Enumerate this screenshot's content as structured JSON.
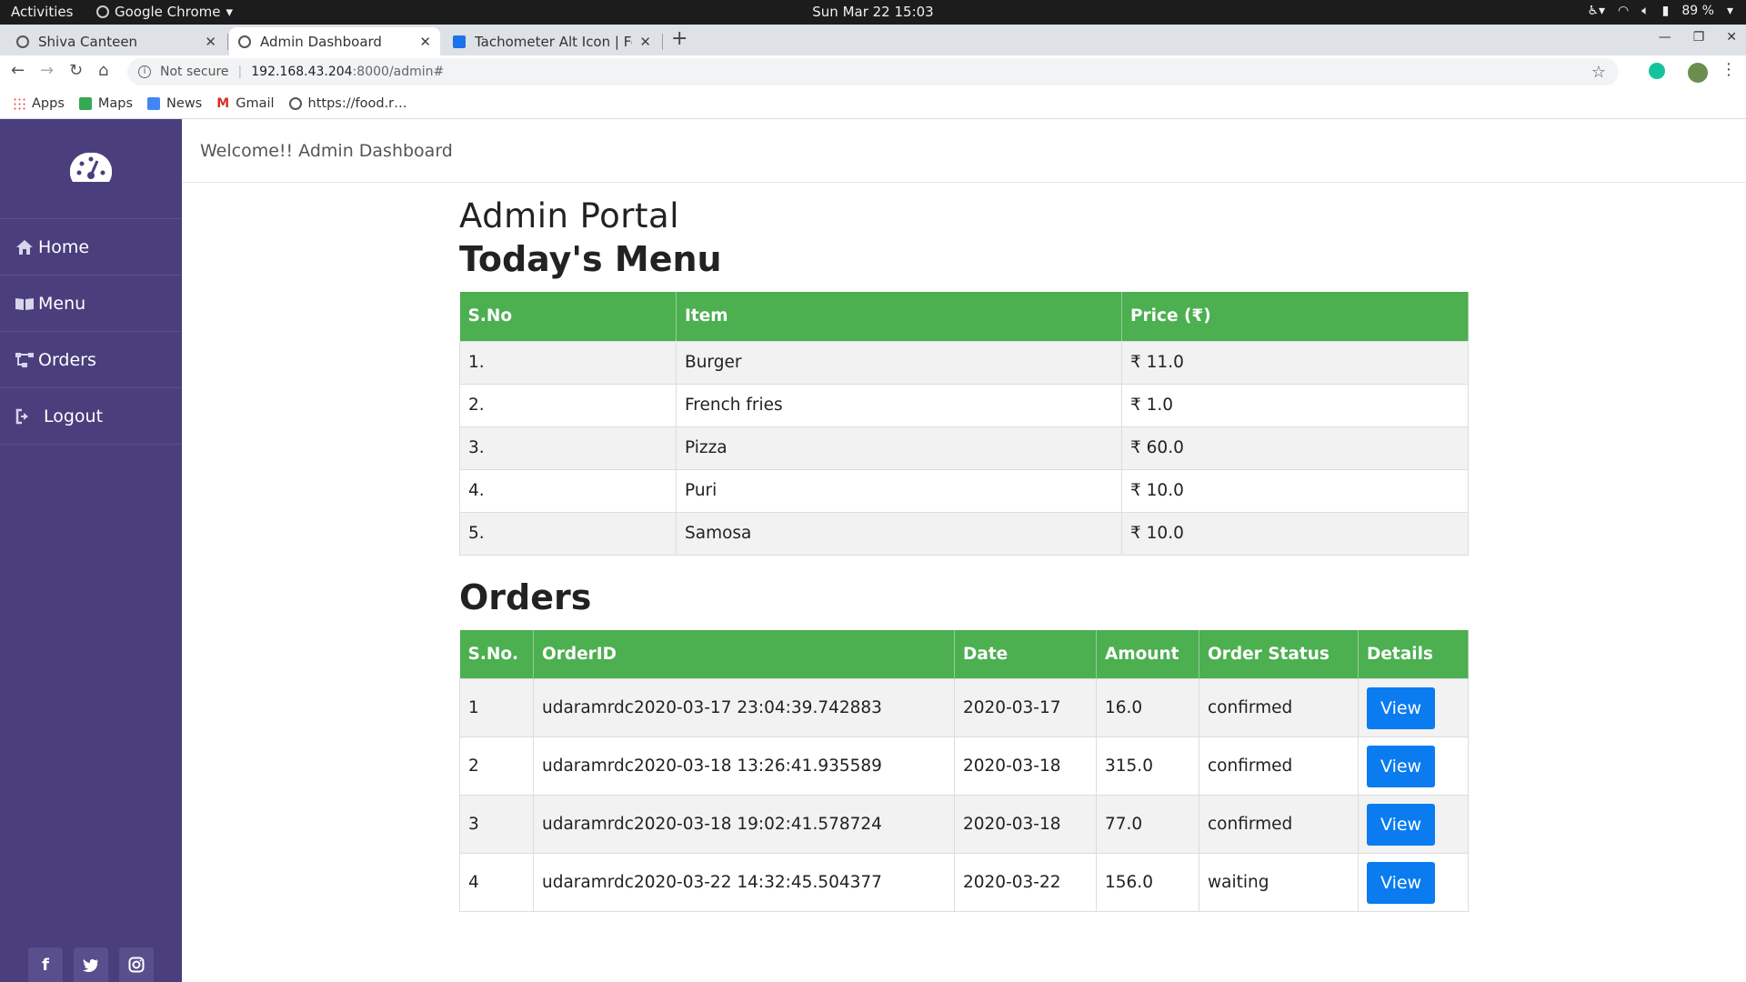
{
  "os": {
    "activities": "Activities",
    "app_name": "Google Chrome",
    "clock": "Sun Mar 22  15:03",
    "battery": "89 %"
  },
  "browser": {
    "tabs": [
      {
        "title": "Shiva Canteen",
        "active": false
      },
      {
        "title": "Admin Dashboard",
        "active": true
      },
      {
        "title": "Tachometer Alt Icon | Fon",
        "active": false
      }
    ],
    "url": {
      "security": "Not secure",
      "host": "192.168.43.204",
      "path": ":8000/admin#"
    },
    "bookmarks": [
      "Apps",
      "Maps",
      "News",
      "Gmail",
      "https://food.r…"
    ]
  },
  "sidebar": {
    "items": [
      {
        "label": "Home",
        "icon": "home-icon"
      },
      {
        "label": "Menu",
        "icon": "book-icon"
      },
      {
        "label": "Orders",
        "icon": "sitemap-icon"
      },
      {
        "label": "Logout",
        "icon": "sign-out-icon"
      }
    ],
    "social": [
      "f",
      "twitter",
      "instagram"
    ],
    "colors": {
      "background": "#4a3e7d"
    }
  },
  "header": {
    "welcome": "Welcome!! Admin Dashboard"
  },
  "main": {
    "title": "Admin Portal",
    "menu_heading": "Today's Menu",
    "menu_table": {
      "headers": [
        "S.No",
        "Item",
        "Price (₹)"
      ],
      "rows": [
        [
          "1.",
          "Burger",
          "₹ 11.0"
        ],
        [
          "2.",
          "French fries",
          "₹ 1.0"
        ],
        [
          "3.",
          "Pizza",
          "₹ 60.0"
        ],
        [
          "4.",
          "Puri",
          "₹ 10.0"
        ],
        [
          "5.",
          "Samosa",
          "₹ 10.0"
        ]
      ]
    },
    "orders_heading": "Orders",
    "orders_table": {
      "headers": [
        "S.No.",
        "OrderID",
        "Date",
        "Amount",
        "Order Status",
        "Details"
      ],
      "rows": [
        [
          "1",
          "udaramrdc2020-03-17 23:04:39.742883",
          "2020-03-17",
          "16.0",
          "confirmed",
          "View"
        ],
        [
          "2",
          "udaramrdc2020-03-18 13:26:41.935589",
          "2020-03-18",
          "315.0",
          "confirmed",
          "View"
        ],
        [
          "3",
          "udaramrdc2020-03-18 19:02:41.578724",
          "2020-03-18",
          "77.0",
          "confirmed",
          "View"
        ],
        [
          "4",
          "udaramrdc2020-03-22 14:32:45.504377",
          "2020-03-22",
          "156.0",
          "waiting",
          "View"
        ]
      ]
    },
    "colors": {
      "table_header": "#4caf50",
      "view_button": "#0a7cf0"
    }
  }
}
